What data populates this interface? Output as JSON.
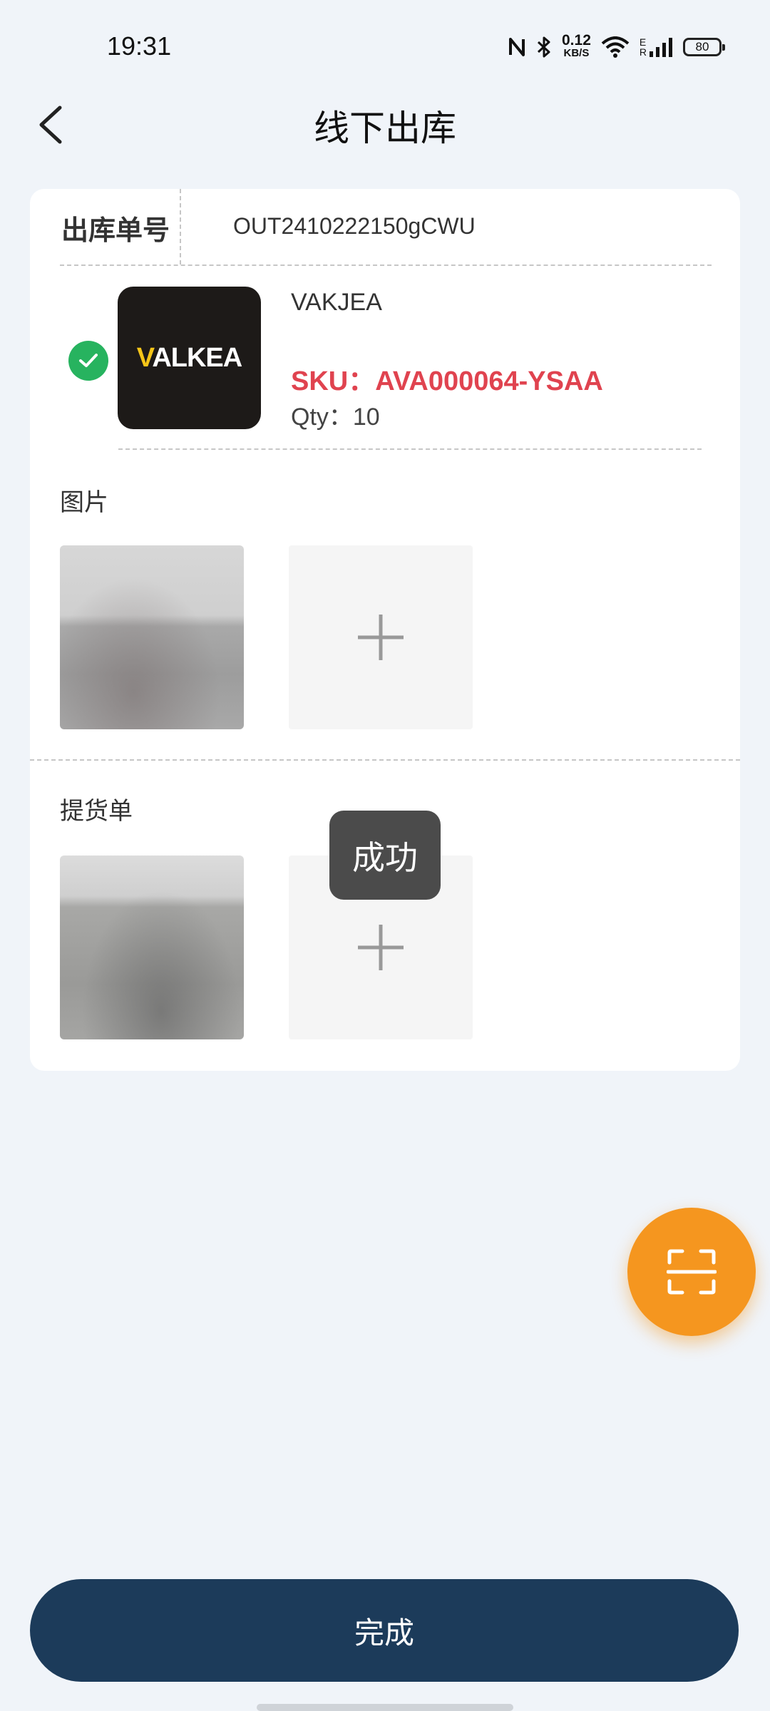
{
  "status_bar": {
    "time": "19:31",
    "net_speed_value": "0.12",
    "net_speed_unit": "KB/S",
    "signal_label": "E",
    "signal_sublabel": "R",
    "battery": "80"
  },
  "header": {
    "title": "线下出库"
  },
  "order": {
    "label": "出库单号",
    "value": "OUT2410222150gCWU"
  },
  "product": {
    "brand_logo_text": "VALKEA",
    "name": "VAKJEA",
    "sku": "SKU：AVA000064-YSAA",
    "qty": "Qty：10",
    "status": "checked"
  },
  "sections": {
    "images_label": "图片",
    "delivery_label": "提货单"
  },
  "toast": {
    "text": "成功"
  },
  "footer": {
    "finish_label": "完成"
  },
  "colors": {
    "accent_orange": "#f5961f",
    "primary_navy": "#1c3b5a",
    "sku_red": "#e0434f",
    "success_green": "#27b35f"
  },
  "icons": [
    "back-arrow-icon",
    "nfc-icon",
    "bluetooth-icon",
    "wifi-icon",
    "signal-icon",
    "battery-icon",
    "check-icon",
    "plus-icon",
    "scan-icon"
  ]
}
